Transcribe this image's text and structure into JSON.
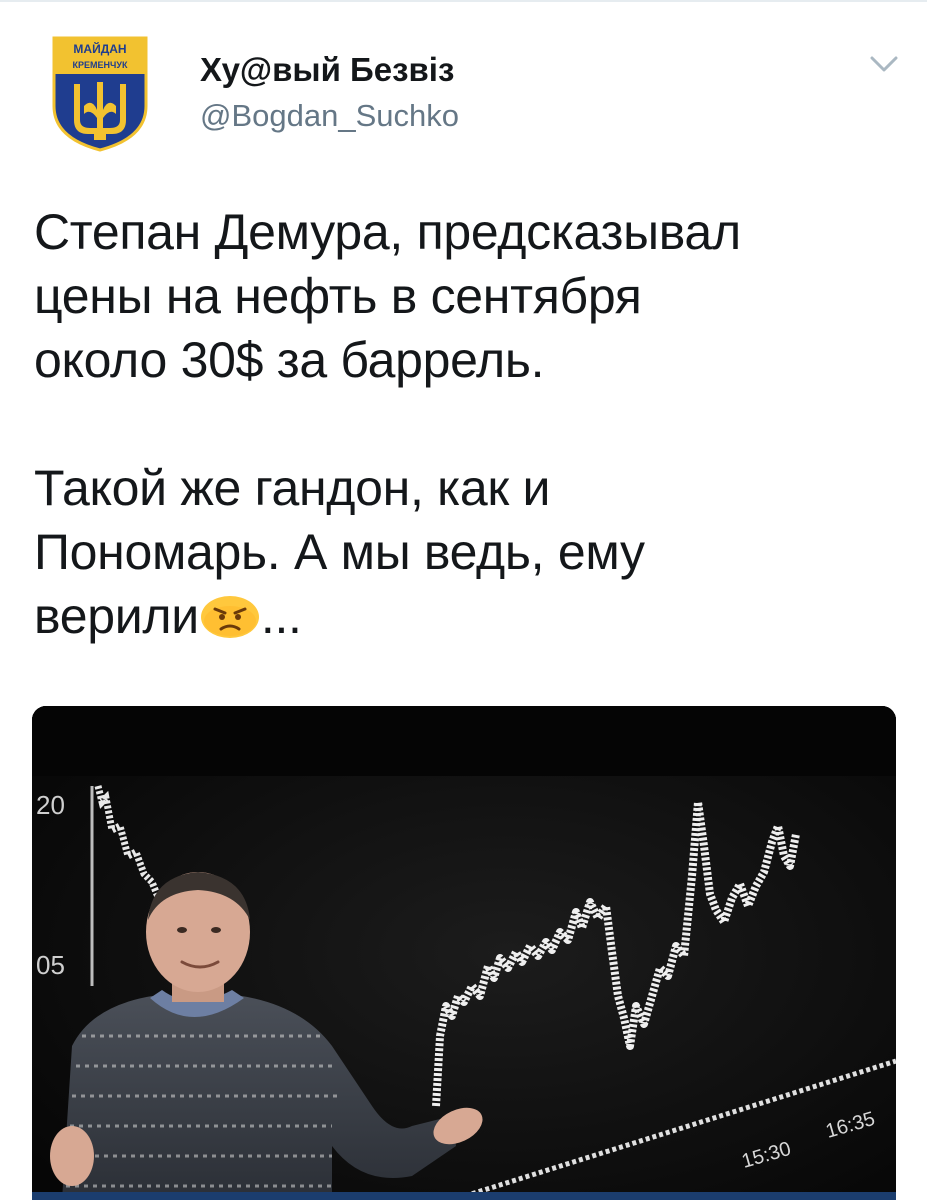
{
  "tweet": {
    "author": {
      "display_name": "Ху@вый Безвіз",
      "handle": "@Bogdan_Suchko",
      "avatar_badge_line1": "МАЙДАН",
      "avatar_badge_line2": "КРЕМЕНЧУК"
    },
    "menu_icon": "chevron-down-icon",
    "text": {
      "paragraph1_lines": [
        "Степан Демура, предсказывал",
        "цены на нефть в сентября",
        "около 30$ за баррель."
      ],
      "paragraph2_lines": [
        "Такой же гандон, как и",
        "Пономарь. А мы ведь, ему"
      ],
      "last_line_text": "верили",
      "last_line_suffix": "...",
      "emoji": "angry-face-emoji"
    },
    "media": {
      "image_label": "photo",
      "left_axis_labels": [
        "20",
        "05"
      ],
      "bottom_time_labels": [
        "15:30",
        "16:35"
      ]
    }
  },
  "colors": {
    "text_primary": "#14171a",
    "text_secondary": "#657786",
    "emblem_blue": "#1f3d8f",
    "emblem_gold": "#f2c230",
    "emoji_yellow": "#ffc83d"
  }
}
